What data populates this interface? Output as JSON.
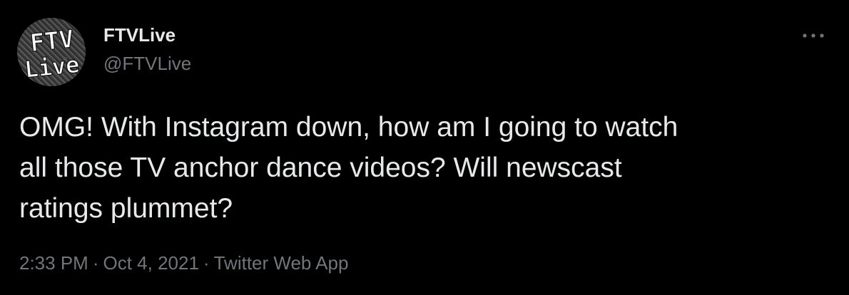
{
  "tweet": {
    "avatar": {
      "line1": "FTV",
      "line2": "Live"
    },
    "display_name": "FTVLive",
    "handle": "@FTVLive",
    "more_icon": "ellipsis-horizontal-icon",
    "text": "OMG! With Instagram down, how am I going to watch\nall those TV anchor dance videos? Will newscast\nratings plummet?",
    "time": "2:33 PM",
    "date": "Oct 4, 2021",
    "source": "Twitter Web App",
    "separator": "·"
  },
  "colors": {
    "background": "#000000",
    "primary_text": "#e7e9ea",
    "secondary_text": "#71767b"
  }
}
